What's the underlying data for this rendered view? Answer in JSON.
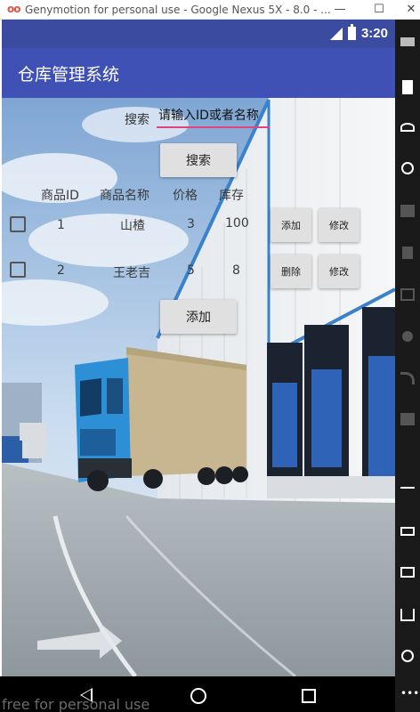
{
  "window": {
    "title": "Genymotion for personal use - Google Nexus 5X - 8.0 - ...",
    "minimize": "—",
    "maximize": "☐",
    "close": "✕"
  },
  "statusbar": {
    "time": "3:20"
  },
  "appbar": {
    "title": "仓库管理系统"
  },
  "search": {
    "label": "搜索",
    "placeholder": "请输入ID或者名称",
    "button": "搜索"
  },
  "table": {
    "headers": [
      "商品ID",
      "商品名称",
      "价格",
      "库存"
    ],
    "rows": [
      {
        "id": "1",
        "name": "山楂",
        "price": "3",
        "stock": "100",
        "action1": "添加",
        "action2": "修改"
      },
      {
        "id": "2",
        "name": "王老吉",
        "price": "5",
        "stock": "8",
        "action1": "删除",
        "action2": "修改"
      }
    ]
  },
  "add_button": "添加",
  "watermark": "free for personal use",
  "colors": {
    "status_bar": "#3a4ba0",
    "app_bar": "#3f51b5",
    "input_underline": "#e0447a",
    "button": "#e0e0e0"
  },
  "icons": [
    "signal-icon",
    "battery-icon",
    "back-icon",
    "home-icon",
    "recents-icon"
  ]
}
